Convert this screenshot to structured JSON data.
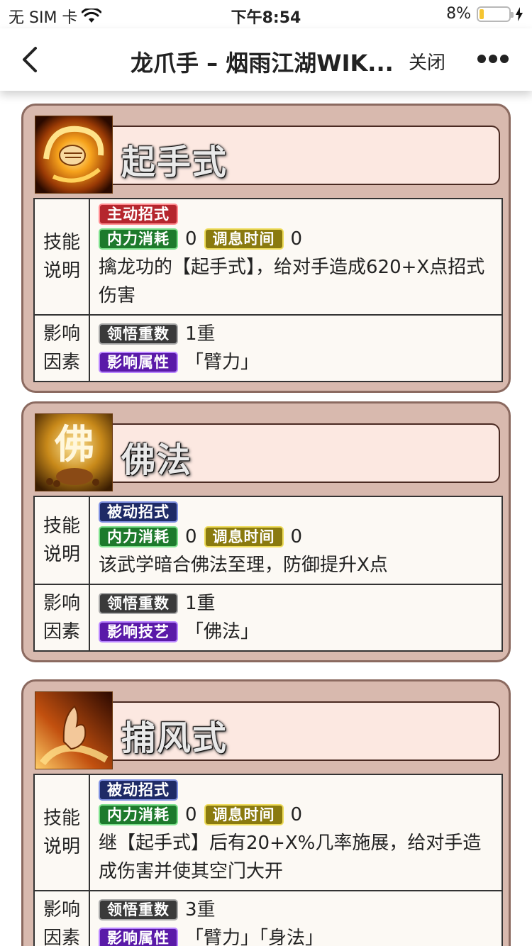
{
  "status_bar": {
    "carrier": "无 SIM 卡",
    "time": "下午8:54",
    "battery": "8%",
    "battery_level": 0.08
  },
  "nav": {
    "title": "龙爪手 – 烟雨江湖WIK...",
    "close_label": "关闭",
    "icons": [
      "back-icon",
      "more-icon"
    ]
  },
  "labels": {
    "desc_label": "技能说明",
    "factor_label": "影响因素"
  },
  "skills": [
    {
      "name": "起手式",
      "type_tag": "主动招式",
      "type_color": "#b5262d",
      "neili_label": "内力消耗",
      "neili_value": "0",
      "tiaoxi_label": "调息时间",
      "tiaoxi_value": "0",
      "description": "擒龙功的【起手式】，给对手造成620+X点招式伤害",
      "realm_label": "领悟重数",
      "realm_value": "1重",
      "attr_label": "影响属性",
      "attr_value": "「臂力」"
    },
    {
      "name": "佛法",
      "type_tag": "被动招式",
      "type_color": "#1e2a66",
      "neili_label": "内力消耗",
      "neili_value": "0",
      "tiaoxi_label": "调息时间",
      "tiaoxi_value": "0",
      "description": "该武学暗合佛法至理，防御提升X点",
      "realm_label": "领悟重数",
      "realm_value": "1重",
      "attr_label": "影响技艺",
      "attr_value": "「佛法」"
    },
    {
      "name": "捕风式",
      "type_tag": "被动招式",
      "type_color": "#1e2a66",
      "neili_label": "内力消耗",
      "neili_value": "0",
      "tiaoxi_label": "调息时间",
      "tiaoxi_value": "0",
      "description": "继【起手式】后有20+X%几率施展，给对手造成伤害并使其空门大开",
      "realm_label": "领悟重数",
      "realm_value": "3重",
      "attr_label": "影响属性",
      "attr_value": "「臂力」「身法」"
    }
  ],
  "colors": {
    "card_bg": "#d8b9ae",
    "card_border": "#8b6a60",
    "table_bg": "#fcf9f4",
    "name_box_bg": "#fce8e1"
  }
}
